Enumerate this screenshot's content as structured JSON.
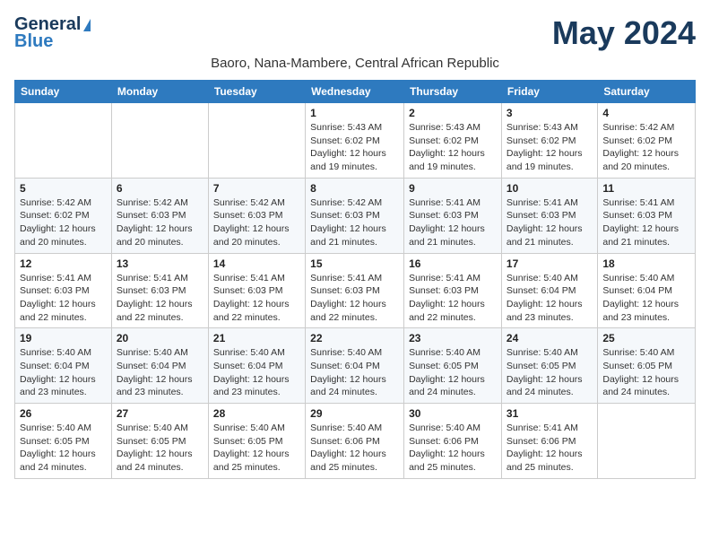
{
  "header": {
    "logo_general": "General",
    "logo_blue": "Blue",
    "month_title": "May 2024",
    "subtitle": "Baoro, Nana-Mambere, Central African Republic"
  },
  "weekdays": [
    "Sunday",
    "Monday",
    "Tuesday",
    "Wednesday",
    "Thursday",
    "Friday",
    "Saturday"
  ],
  "weeks": [
    {
      "days": [
        {
          "num": "",
          "info": ""
        },
        {
          "num": "",
          "info": ""
        },
        {
          "num": "",
          "info": ""
        },
        {
          "num": "1",
          "info": "Sunrise: 5:43 AM\nSunset: 6:02 PM\nDaylight: 12 hours and 19 minutes."
        },
        {
          "num": "2",
          "info": "Sunrise: 5:43 AM\nSunset: 6:02 PM\nDaylight: 12 hours and 19 minutes."
        },
        {
          "num": "3",
          "info": "Sunrise: 5:43 AM\nSunset: 6:02 PM\nDaylight: 12 hours and 19 minutes."
        },
        {
          "num": "4",
          "info": "Sunrise: 5:42 AM\nSunset: 6:02 PM\nDaylight: 12 hours and 20 minutes."
        }
      ]
    },
    {
      "days": [
        {
          "num": "5",
          "info": "Sunrise: 5:42 AM\nSunset: 6:02 PM\nDaylight: 12 hours and 20 minutes."
        },
        {
          "num": "6",
          "info": "Sunrise: 5:42 AM\nSunset: 6:03 PM\nDaylight: 12 hours and 20 minutes."
        },
        {
          "num": "7",
          "info": "Sunrise: 5:42 AM\nSunset: 6:03 PM\nDaylight: 12 hours and 20 minutes."
        },
        {
          "num": "8",
          "info": "Sunrise: 5:42 AM\nSunset: 6:03 PM\nDaylight: 12 hours and 21 minutes."
        },
        {
          "num": "9",
          "info": "Sunrise: 5:41 AM\nSunset: 6:03 PM\nDaylight: 12 hours and 21 minutes."
        },
        {
          "num": "10",
          "info": "Sunrise: 5:41 AM\nSunset: 6:03 PM\nDaylight: 12 hours and 21 minutes."
        },
        {
          "num": "11",
          "info": "Sunrise: 5:41 AM\nSunset: 6:03 PM\nDaylight: 12 hours and 21 minutes."
        }
      ]
    },
    {
      "days": [
        {
          "num": "12",
          "info": "Sunrise: 5:41 AM\nSunset: 6:03 PM\nDaylight: 12 hours and 22 minutes."
        },
        {
          "num": "13",
          "info": "Sunrise: 5:41 AM\nSunset: 6:03 PM\nDaylight: 12 hours and 22 minutes."
        },
        {
          "num": "14",
          "info": "Sunrise: 5:41 AM\nSunset: 6:03 PM\nDaylight: 12 hours and 22 minutes."
        },
        {
          "num": "15",
          "info": "Sunrise: 5:41 AM\nSunset: 6:03 PM\nDaylight: 12 hours and 22 minutes."
        },
        {
          "num": "16",
          "info": "Sunrise: 5:41 AM\nSunset: 6:03 PM\nDaylight: 12 hours and 22 minutes."
        },
        {
          "num": "17",
          "info": "Sunrise: 5:40 AM\nSunset: 6:04 PM\nDaylight: 12 hours and 23 minutes."
        },
        {
          "num": "18",
          "info": "Sunrise: 5:40 AM\nSunset: 6:04 PM\nDaylight: 12 hours and 23 minutes."
        }
      ]
    },
    {
      "days": [
        {
          "num": "19",
          "info": "Sunrise: 5:40 AM\nSunset: 6:04 PM\nDaylight: 12 hours and 23 minutes."
        },
        {
          "num": "20",
          "info": "Sunrise: 5:40 AM\nSunset: 6:04 PM\nDaylight: 12 hours and 23 minutes."
        },
        {
          "num": "21",
          "info": "Sunrise: 5:40 AM\nSunset: 6:04 PM\nDaylight: 12 hours and 23 minutes."
        },
        {
          "num": "22",
          "info": "Sunrise: 5:40 AM\nSunset: 6:04 PM\nDaylight: 12 hours and 24 minutes."
        },
        {
          "num": "23",
          "info": "Sunrise: 5:40 AM\nSunset: 6:05 PM\nDaylight: 12 hours and 24 minutes."
        },
        {
          "num": "24",
          "info": "Sunrise: 5:40 AM\nSunset: 6:05 PM\nDaylight: 12 hours and 24 minutes."
        },
        {
          "num": "25",
          "info": "Sunrise: 5:40 AM\nSunset: 6:05 PM\nDaylight: 12 hours and 24 minutes."
        }
      ]
    },
    {
      "days": [
        {
          "num": "26",
          "info": "Sunrise: 5:40 AM\nSunset: 6:05 PM\nDaylight: 12 hours and 24 minutes."
        },
        {
          "num": "27",
          "info": "Sunrise: 5:40 AM\nSunset: 6:05 PM\nDaylight: 12 hours and 24 minutes."
        },
        {
          "num": "28",
          "info": "Sunrise: 5:40 AM\nSunset: 6:05 PM\nDaylight: 12 hours and 25 minutes."
        },
        {
          "num": "29",
          "info": "Sunrise: 5:40 AM\nSunset: 6:06 PM\nDaylight: 12 hours and 25 minutes."
        },
        {
          "num": "30",
          "info": "Sunrise: 5:40 AM\nSunset: 6:06 PM\nDaylight: 12 hours and 25 minutes."
        },
        {
          "num": "31",
          "info": "Sunrise: 5:41 AM\nSunset: 6:06 PM\nDaylight: 12 hours and 25 minutes."
        },
        {
          "num": "",
          "info": ""
        }
      ]
    }
  ]
}
